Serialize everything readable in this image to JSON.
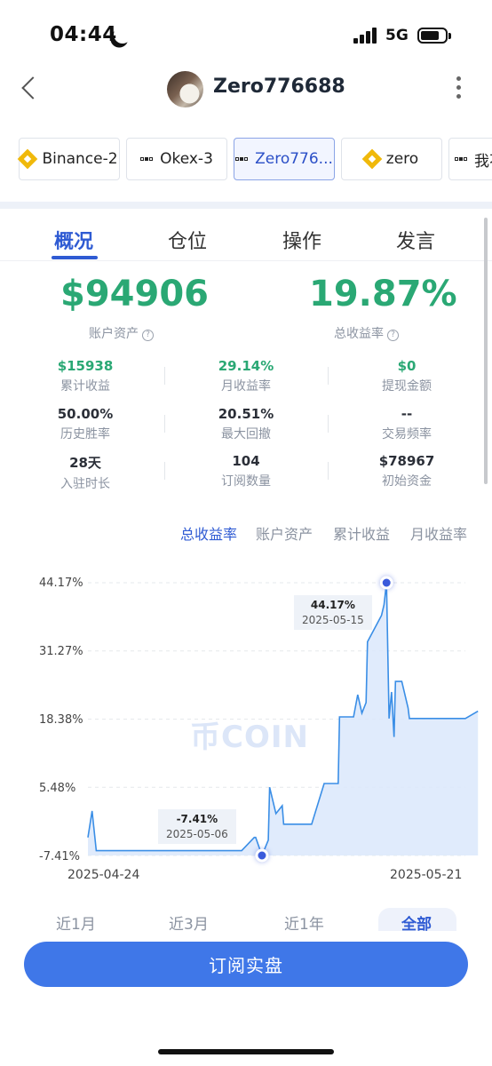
{
  "status": {
    "time": "04:44",
    "network": "5G"
  },
  "header": {
    "username": "Zero776688"
  },
  "accounts": [
    {
      "label": "Binance-2",
      "icon": "binance-icon"
    },
    {
      "label": "Okex-3",
      "icon": "okx-icon"
    },
    {
      "label": "Zero776...",
      "icon": "okx-icon",
      "active": true
    },
    {
      "label": "zero",
      "icon": "binance-icon"
    },
    {
      "label": "我不",
      "icon": "okx-icon"
    }
  ],
  "tabs": [
    "概况",
    "仓位",
    "操作",
    "发言"
  ],
  "summary": {
    "assets_value": "$94906",
    "assets_label": "账户资产",
    "return_value": "19.87%",
    "return_label": "总收益率"
  },
  "metrics": [
    {
      "value": "$15938",
      "label": "累计收益"
    },
    {
      "value": "29.14%",
      "label": "月收益率"
    },
    {
      "value": "$0",
      "label": "提现金额"
    },
    {
      "value": "50.00%",
      "label": "历史胜率"
    },
    {
      "value": "20.51%",
      "label": "最大回撤"
    },
    {
      "value": "--",
      "label": "交易频率"
    },
    {
      "value": "28天",
      "label": "入驻时长"
    },
    {
      "value": "104",
      "label": "订阅数量"
    },
    {
      "value": "$78967",
      "label": "初始资金"
    }
  ],
  "chart_tabs": [
    "总收益率",
    "账户资产",
    "累计收益",
    "月收益率"
  ],
  "chart_data": {
    "type": "area",
    "y_ticks": [
      "44.17%",
      "31.27%",
      "18.38%",
      "5.48%",
      "-7.41%"
    ],
    "ylim": [
      -7.41,
      44.17
    ],
    "x_ticks": [
      "2025-04-24",
      "2025-05-21"
    ],
    "watermark": "币COIN",
    "series": [
      {
        "x": [
          "2025-04-24",
          "2025-04-24",
          "2025-04-24",
          "2025-04-24",
          "2025-05-05",
          "2025-05-05",
          "2025-05-06",
          "2025-05-06",
          "2025-05-06",
          "2025-05-07",
          "2025-05-07",
          "2025-05-07",
          "2025-05-08",
          "2025-05-08",
          "2025-05-10",
          "2025-05-10",
          "2025-05-11",
          "2025-05-11",
          "2025-05-12",
          "2025-05-12",
          "2025-05-13",
          "2025-05-13",
          "2025-05-13",
          "2025-05-13",
          "2025-05-14",
          "2025-05-14",
          "2025-05-15",
          "2025-05-15",
          "2025-05-15",
          "2025-05-15",
          "2025-05-15",
          "2025-05-15",
          "2025-05-16",
          "2025-05-16",
          "2025-05-16",
          "2025-05-17",
          "2025-05-21",
          "2025-05-21"
        ],
        "values": [
          -4.0,
          1.0,
          -6.5,
          -6.5,
          -6.5,
          -4.0,
          -4.0,
          -7.41,
          -4.5,
          5.5,
          0.5,
          2.0,
          -1.5,
          -1.5,
          -1.5,
          6.2,
          6.2,
          6.2,
          18.8,
          18.8,
          18.8,
          23.0,
          19.5,
          21.5,
          33.0,
          37.5,
          38.0,
          40.0,
          44.17,
          18.5,
          23.5,
          15.0,
          25.5,
          25.5,
          20.5,
          18.5,
          18.5,
          19.87
        ]
      }
    ],
    "annotations": [
      {
        "value": "44.17%",
        "date": "2025-05-15"
      },
      {
        "value": "-7.41%",
        "date": "2025-05-06"
      }
    ]
  },
  "ranges": [
    "近1月",
    "近3月",
    "近1年",
    "全部"
  ],
  "subscribe_label": "订阅实盘",
  "colors": {
    "accent": "#2f5bd3",
    "positive": "#2aa874",
    "button": "#3f77e8",
    "line": "#3a8ee6",
    "area": "#dbe7fb"
  }
}
